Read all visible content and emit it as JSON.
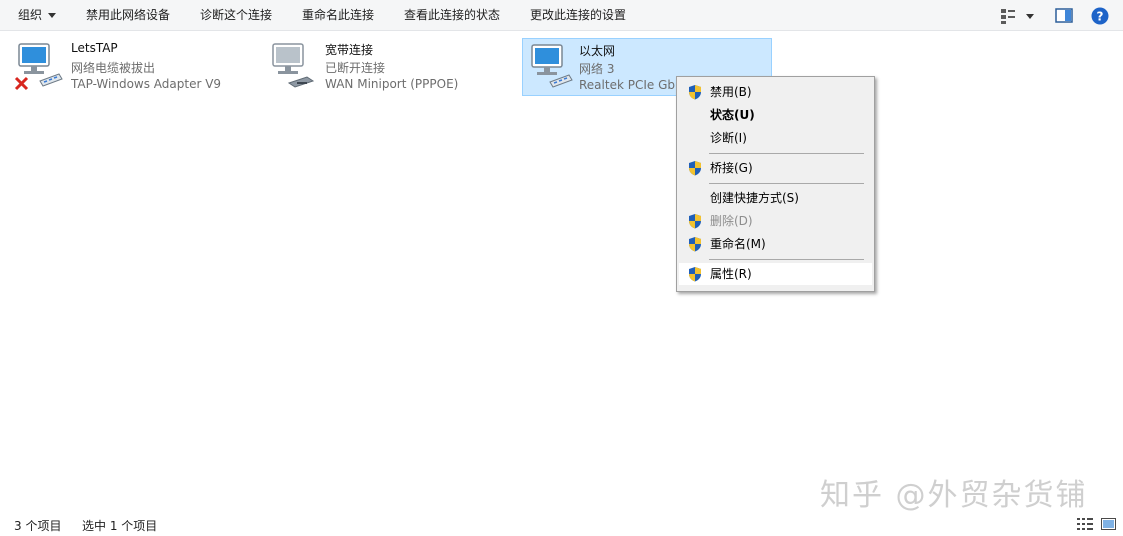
{
  "toolbar": {
    "organize": "组织",
    "disable_device": "禁用此网络设备",
    "diagnose": "诊断这个连接",
    "rename": "重命名此连接",
    "view_status": "查看此连接的状态",
    "change_settings": "更改此连接的设置",
    "view_options_icon": "view-options-icon",
    "preview_pane_icon": "preview-pane-icon",
    "help_icon": "help-icon"
  },
  "adapters": [
    {
      "name": "LetsTAP",
      "status": "网络电缆被拔出",
      "device": "TAP-Windows Adapter V9",
      "icon": "network-disconnected-icon"
    },
    {
      "name": "宽带连接",
      "status": "已断开连接",
      "device": "WAN Miniport (PPPOE)",
      "icon": "broadband-icon"
    },
    {
      "name": "以太网",
      "status": "网络 3",
      "device": "Realtek PCIe GbE Family Controller",
      "icon": "network-icon"
    }
  ],
  "context_menu": {
    "items": [
      {
        "label": "禁用(B)",
        "shield": true
      },
      {
        "label": "状态(U)",
        "shield": false,
        "bold": true
      },
      {
        "label": "诊断(I)",
        "shield": false
      },
      {
        "label": "桥接(G)",
        "shield": true
      },
      {
        "label": "创建快捷方式(S)",
        "shield": false
      },
      {
        "label": "删除(D)",
        "shield": true,
        "disabled": true
      },
      {
        "label": "重命名(M)",
        "shield": true
      },
      {
        "label": "属性(R)",
        "shield": true,
        "highlighted": true
      }
    ]
  },
  "status_bar": {
    "item_count": "3 个项目",
    "selected": "选中 1 个项目"
  },
  "watermark": "知乎 @外贸杂货铺",
  "colors": {
    "selection_bg": "#cce8ff",
    "selection_border": "#99d1ff",
    "menu_bg": "#f0f0f0",
    "help_blue": "#1d63c8",
    "error_red": "#d8261f"
  }
}
